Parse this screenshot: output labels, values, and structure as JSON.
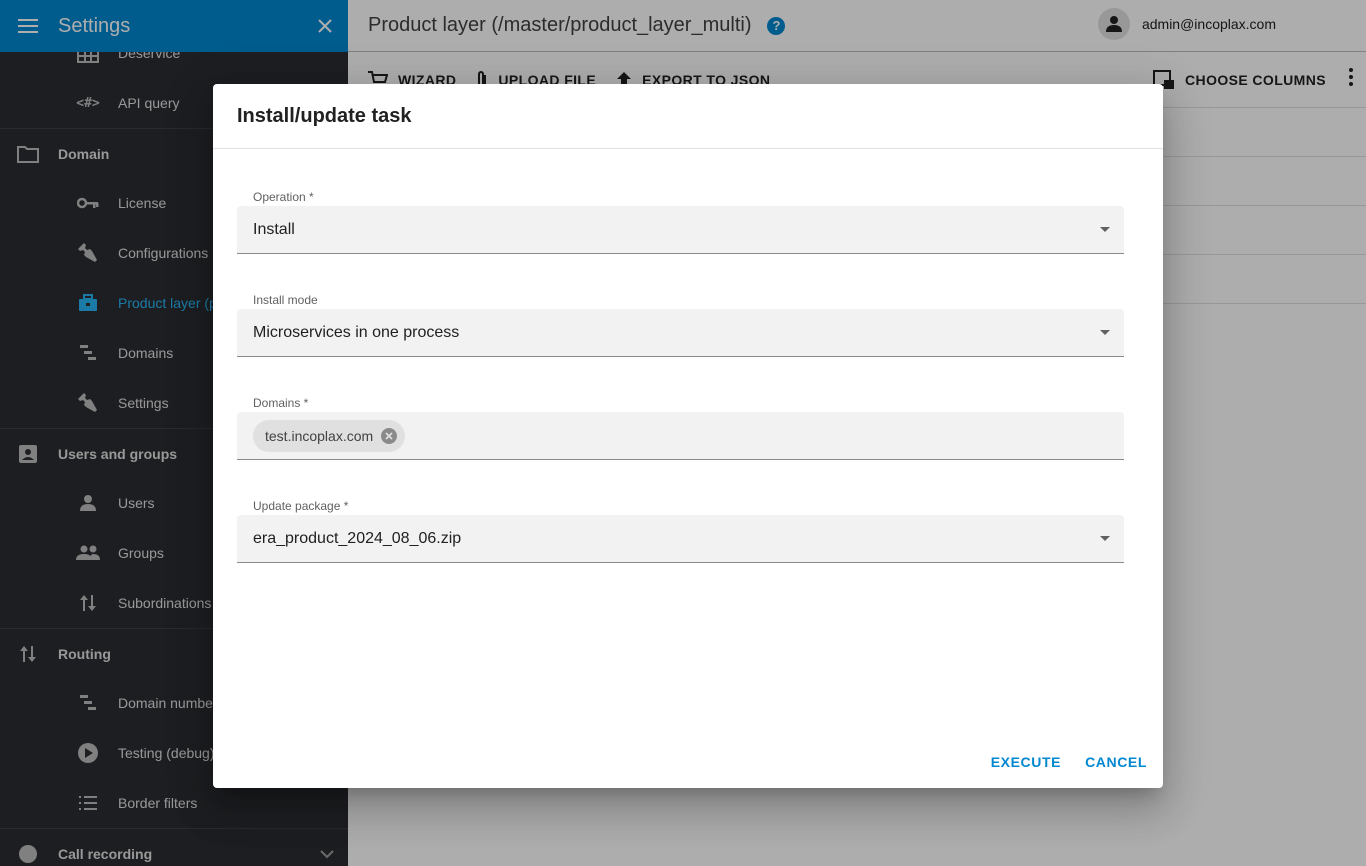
{
  "sidebar": {
    "title": "Settings",
    "items": [
      {
        "label": "Deservice",
        "icon": "grid-icon",
        "type": "sub"
      },
      {
        "label": "API query",
        "icon": "code-icon",
        "type": "sub"
      },
      {
        "label": "Domain",
        "icon": "folder-icon",
        "type": "group"
      },
      {
        "label": "License",
        "icon": "key-icon",
        "type": "sub"
      },
      {
        "label": "Configurations",
        "icon": "wrench-icon",
        "type": "sub"
      },
      {
        "label": "Product layer (p",
        "icon": "briefcase-icon",
        "type": "sub",
        "active": true
      },
      {
        "label": "Domains",
        "icon": "tree-icon",
        "type": "sub"
      },
      {
        "label": "Settings",
        "icon": "wrench-icon",
        "type": "sub"
      },
      {
        "label": "Users and groups",
        "icon": "contact-icon",
        "type": "group"
      },
      {
        "label": "Users",
        "icon": "person-icon",
        "type": "sub"
      },
      {
        "label": "Groups",
        "icon": "people-icon",
        "type": "sub"
      },
      {
        "label": "Subordinations",
        "icon": "sort-arrows-icon",
        "type": "sub"
      },
      {
        "label": "Routing",
        "icon": "sort-arrows-icon",
        "type": "group"
      },
      {
        "label": "Domain numbe",
        "icon": "tree-icon",
        "type": "sub"
      },
      {
        "label": "Testing (debug)",
        "icon": "play-icon",
        "type": "sub"
      },
      {
        "label": "Border filters",
        "icon": "list-icon",
        "type": "sub"
      },
      {
        "label": "Call recording",
        "icon": "record-icon",
        "type": "group"
      }
    ]
  },
  "header": {
    "title": "Product layer (/master/product_layer_multi)",
    "help": "?",
    "user_email": "admin@incoplax.com"
  },
  "toolbar": {
    "wizard": "WIZARD",
    "upload": "UPLOAD FILE",
    "export": "EXPORT TO JSON",
    "choose_columns": "CHOOSE COLUMNS"
  },
  "dialog": {
    "title": "Install/update task",
    "operation": {
      "label": "Operation *",
      "value": "Install"
    },
    "install_mode": {
      "label": "Install mode",
      "value": "Microservices in one process"
    },
    "domains": {
      "label": "Domains *",
      "chips": [
        "test.incoplax.com"
      ]
    },
    "update_package": {
      "label": "Update package *",
      "value": "era_product_2024_08_06.zip"
    },
    "execute": "EXECUTE",
    "cancel": "CANCEL"
  },
  "colors": {
    "accent": "#0288d1",
    "sidebar_bg": "#2b2d31",
    "active_item": "#29b6f6"
  }
}
